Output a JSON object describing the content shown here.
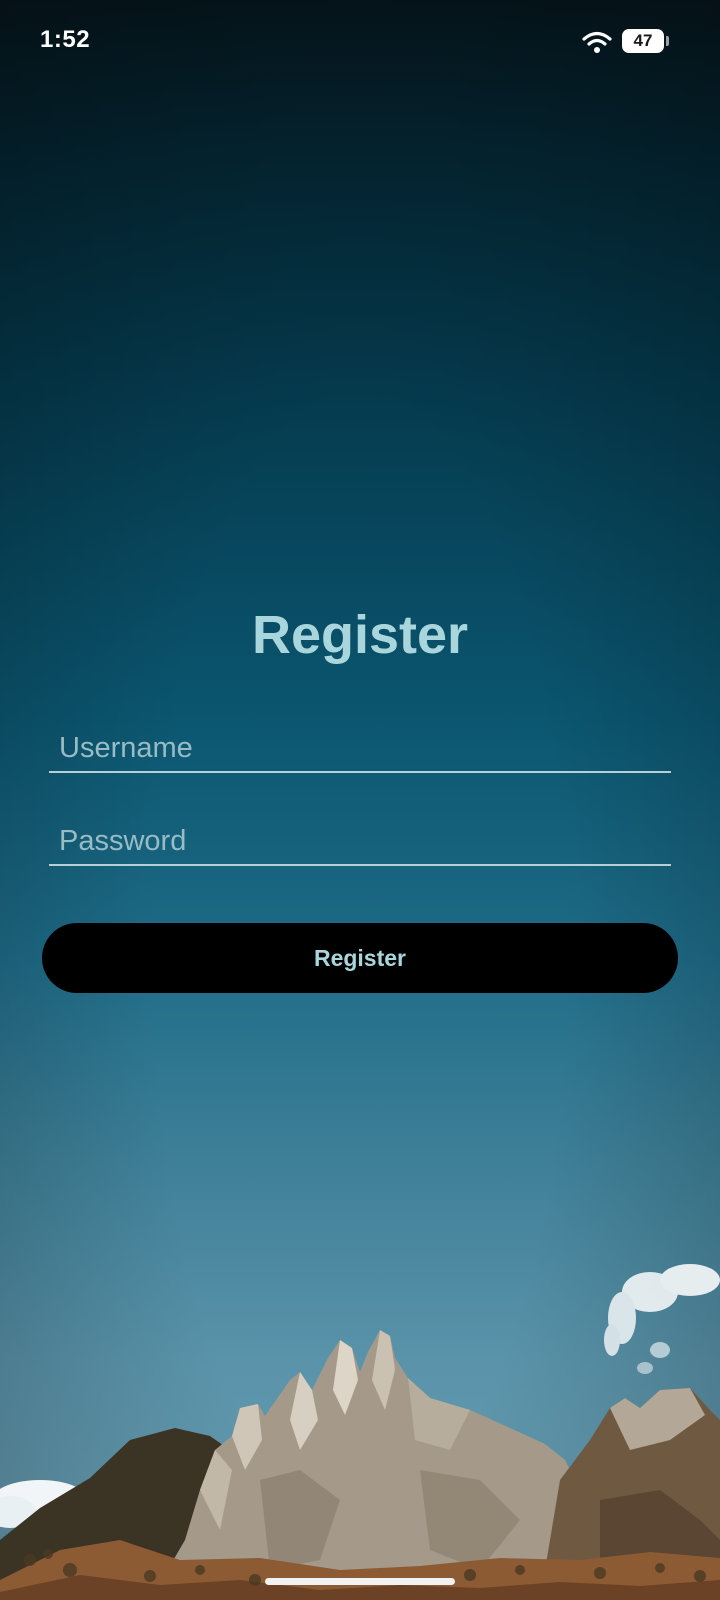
{
  "status_bar": {
    "time": "1:52",
    "battery_level": "47",
    "icons": [
      "wifi-icon",
      "battery-icon"
    ]
  },
  "form": {
    "title": "Register",
    "username": {
      "value": "",
      "placeholder": "Username"
    },
    "password": {
      "value": "",
      "placeholder": "Password"
    },
    "submit_label": "Register"
  },
  "background": {
    "description_colors": [
      "#06161d",
      "#0b5670",
      "#6b9fb3"
    ]
  },
  "colors": {
    "title": "#a9d6dd",
    "button_bg": "#000000",
    "button_text": "#a9d6dd",
    "field_underline": "#b8cfd6"
  }
}
